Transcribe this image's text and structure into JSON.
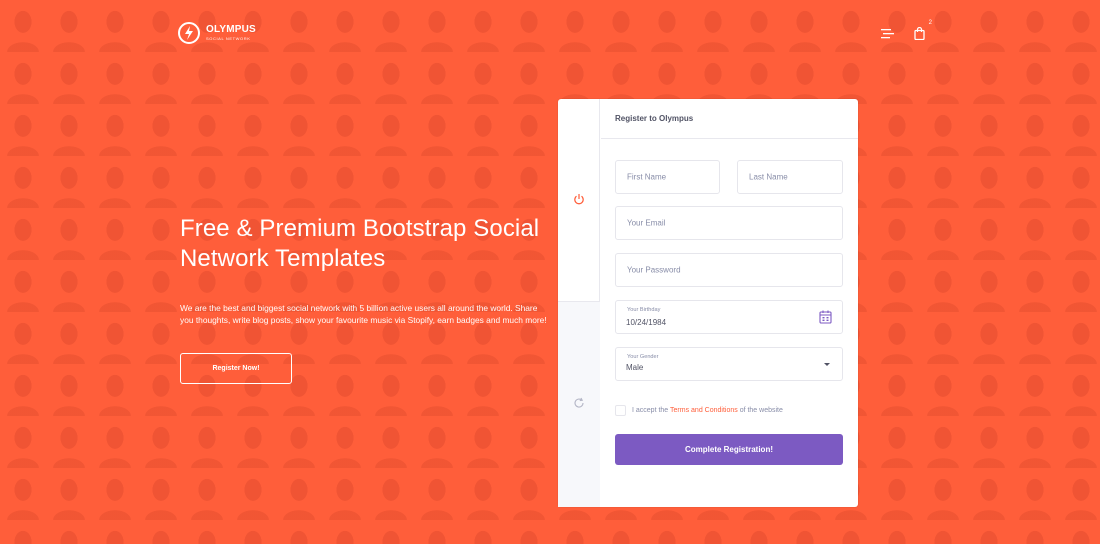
{
  "brand": {
    "name": "OLYMPUS",
    "tagline": "SOCIAL NETWORK"
  },
  "header": {
    "cart_count": "2",
    "icons": [
      "menu-lines-icon",
      "shopping-bag-icon"
    ]
  },
  "hero": {
    "title_line1": "Free & Premium Bootstrap Social",
    "title_line2": "Network Templates",
    "description_line1": "We are the best and biggest social network with 5 billion active users all around the world. Share",
    "description_line2": "you thoughts, write blog posts, show your favourite music via Stopify, earn badges and much more!",
    "cta_label": "Register Now!"
  },
  "form": {
    "title": "Register to Olympus",
    "first_name_placeholder": "First Name",
    "last_name_placeholder": "Last Name",
    "email_placeholder": "Your Email",
    "password_placeholder": "Your Password",
    "birthday_label": "Your Birthday",
    "birthday_value": "10/24/1984",
    "gender_label": "Your Gender",
    "gender_value": "Male",
    "terms_prefix": "I accept the",
    "terms_link": "Terms and Conditions",
    "terms_suffix": "of the website",
    "submit_label": "Complete Registration!"
  },
  "colors": {
    "accent": "#ff5e3a",
    "primary_button": "#7c5ac2",
    "text": "#515365",
    "muted": "#888da8"
  }
}
